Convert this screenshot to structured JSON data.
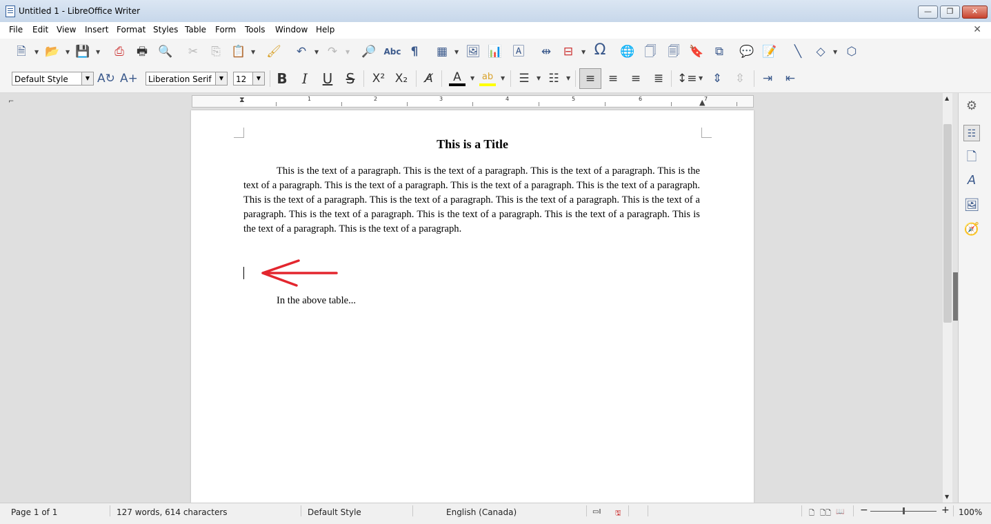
{
  "window": {
    "title": "Untitled 1 - LibreOffice Writer",
    "minimize": "—",
    "restore": "❐",
    "close": "✕"
  },
  "menu": {
    "items": [
      "File",
      "Edit",
      "View",
      "Insert",
      "Format",
      "Styles",
      "Table",
      "Form",
      "Tools",
      "Window",
      "Help"
    ],
    "close_document": "✕"
  },
  "toolbar_standard": {
    "icons": [
      "new-icon",
      "open-icon",
      "save-icon",
      "export-pdf-icon",
      "print-icon",
      "print-preview-icon",
      "cut-icon",
      "copy-icon",
      "paste-icon",
      "clone-formatting-icon",
      "undo-icon",
      "redo-icon",
      "find-replace-icon",
      "spelling-icon",
      "formatting-marks-icon",
      "insert-table-icon",
      "insert-image-icon",
      "insert-chart-icon",
      "insert-textbox-icon",
      "page-break-icon",
      "insert-field-icon",
      "special-character-icon",
      "hyperlink-icon",
      "footnote-icon",
      "endnote-icon",
      "bookmark-icon",
      "cross-reference-icon",
      "comment-icon",
      "track-changes-icon",
      "line-icon",
      "basic-shapes-icon",
      "draw-functions-icon"
    ]
  },
  "toolbar_formatting": {
    "paragraph_style": "Default Style",
    "font_name": "Liberation Serif",
    "font_size": "12",
    "icons": [
      "update-style-icon",
      "new-style-icon",
      "bold-icon",
      "italic-icon",
      "underline-icon",
      "strikethrough-icon",
      "superscript-icon",
      "subscript-icon",
      "clear-formatting-icon",
      "font-color-icon",
      "highlight-icon",
      "unordered-list-icon",
      "ordered-list-icon",
      "align-left-icon",
      "align-center-icon",
      "align-right-icon",
      "justify-icon",
      "line-spacing-icon",
      "increase-paragraph-spacing-icon",
      "decrease-paragraph-spacing-icon",
      "increase-indent-icon",
      "decrease-indent-icon"
    ],
    "font_color": "#000000",
    "highlight_color": "#ffff00"
  },
  "ruler": {
    "numbers": [
      "1",
      "2",
      "3",
      "4",
      "5",
      "6",
      "7"
    ]
  },
  "document": {
    "title": "This is a Title",
    "paragraph": "This is the text of a paragraph.  This is the text of a paragraph.  This is the text of a paragraph.  This is the text of a paragraph.  This is the text of a paragraph.  This is the text of a paragraph.  This is the text of a paragraph.  This is the text of a paragraph.  This is the text of a paragraph.  This is the text of a paragraph.  This is the text of a paragraph.  This is the text of a paragraph.  This is the text of a paragraph.  This is the text of a paragraph.  This is the text of a paragraph.  This is the text of a paragraph.",
    "paragraph2": "In the above table...",
    "annotation_color": "#e3262e"
  },
  "sidebar": {
    "icons": [
      "properties-icon",
      "page-deck-icon",
      "page-icon",
      "styles-icon",
      "gallery-icon",
      "navigator-icon"
    ]
  },
  "status": {
    "page": "Page 1 of 1",
    "word_count": "127 words, 614 characters",
    "page_style": "Default Style",
    "language": "English (Canada)",
    "zoom_minus": "−",
    "zoom_plus": "+",
    "zoom": "100%"
  }
}
